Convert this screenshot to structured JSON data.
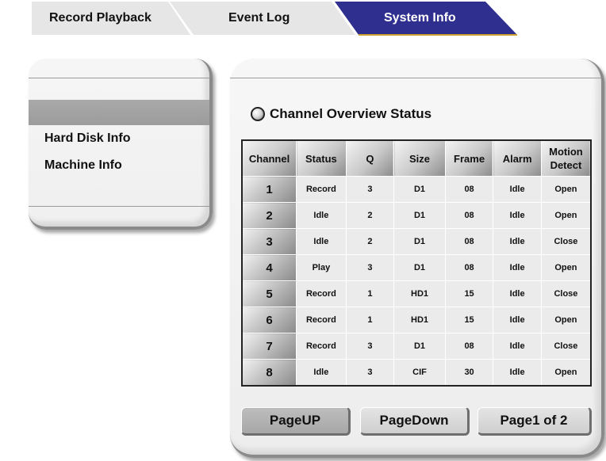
{
  "tabs": [
    {
      "label": "Record Playback",
      "active": false
    },
    {
      "label": "Event Log",
      "active": false
    },
    {
      "label": "System Info",
      "active": true
    }
  ],
  "colors": {
    "active_tab": "#2f2f8f",
    "inactive_tab": "#e6e6e6"
  },
  "sidebar": {
    "items": [
      {
        "label": "",
        "selected": true
      },
      {
        "label": "Hard Disk Info",
        "selected": false
      },
      {
        "label": "Machine Info",
        "selected": false
      }
    ]
  },
  "main": {
    "title": "Channel Overview Status",
    "title_icon": "radio-icon",
    "table": {
      "headers": [
        "Channel",
        "Status",
        "Q",
        "Size",
        "Frame",
        "Alarm",
        "Motion Detect"
      ],
      "rows": [
        [
          "1",
          "Record",
          "3",
          "D1",
          "08",
          "Idle",
          "Open"
        ],
        [
          "2",
          "Idle",
          "2",
          "D1",
          "08",
          "Idle",
          "Open"
        ],
        [
          "3",
          "Idle",
          "2",
          "D1",
          "08",
          "Idle",
          "Close"
        ],
        [
          "4",
          "Play",
          "3",
          "D1",
          "08",
          "Idle",
          "Open"
        ],
        [
          "5",
          "Record",
          "1",
          "HD1",
          "15",
          "Idle",
          "Close"
        ],
        [
          "6",
          "Record",
          "1",
          "HD1",
          "15",
          "Idle",
          "Open"
        ],
        [
          "7",
          "Record",
          "3",
          "D1",
          "08",
          "Idle",
          "Close"
        ],
        [
          "8",
          "Idle",
          "3",
          "CIF",
          "30",
          "Idle",
          "Open"
        ]
      ]
    },
    "buttons": {
      "page_up": "PageUP",
      "page_down": "PageDown",
      "page_indicator": "Page1 of 2"
    }
  }
}
